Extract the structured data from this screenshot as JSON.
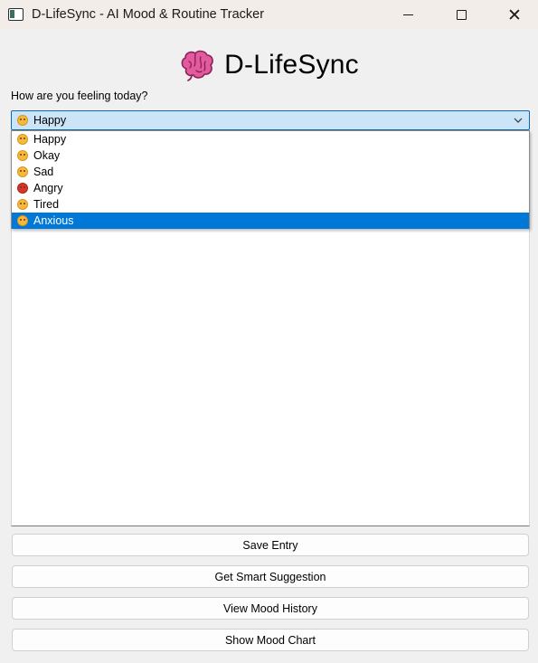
{
  "window": {
    "title": "D-LifeSync - AI Mood & Routine Tracker",
    "min_glyph": "",
    "max_glyph": "",
    "close_glyph": "✕"
  },
  "header": {
    "icon": "brain-icon",
    "title": "D-LifeSync"
  },
  "mood": {
    "prompt": "How are you feeling today?",
    "selected": "Happy",
    "selected_icon": "smiling-face-icon",
    "options": [
      {
        "label": "Happy",
        "icon": "smiling-face-icon"
      },
      {
        "label": "Okay",
        "icon": "neutral-face-icon"
      },
      {
        "label": "Sad",
        "icon": "sad-face-icon"
      },
      {
        "label": "Angry",
        "icon": "angry-face-icon"
      },
      {
        "label": "Tired",
        "icon": "tired-face-icon"
      },
      {
        "label": "Anxious",
        "icon": "anxious-face-icon"
      }
    ],
    "highlighted_option": "Anxious"
  },
  "notes": {
    "value": ""
  },
  "buttons": {
    "save": "Save Entry",
    "suggest": "Get Smart Suggestion",
    "history": "View Mood History",
    "chart": "Show Mood Chart"
  },
  "colors": {
    "combo_bg": "#cce4f7",
    "highlight": "#0078d7",
    "brain": "#e45a9e"
  }
}
